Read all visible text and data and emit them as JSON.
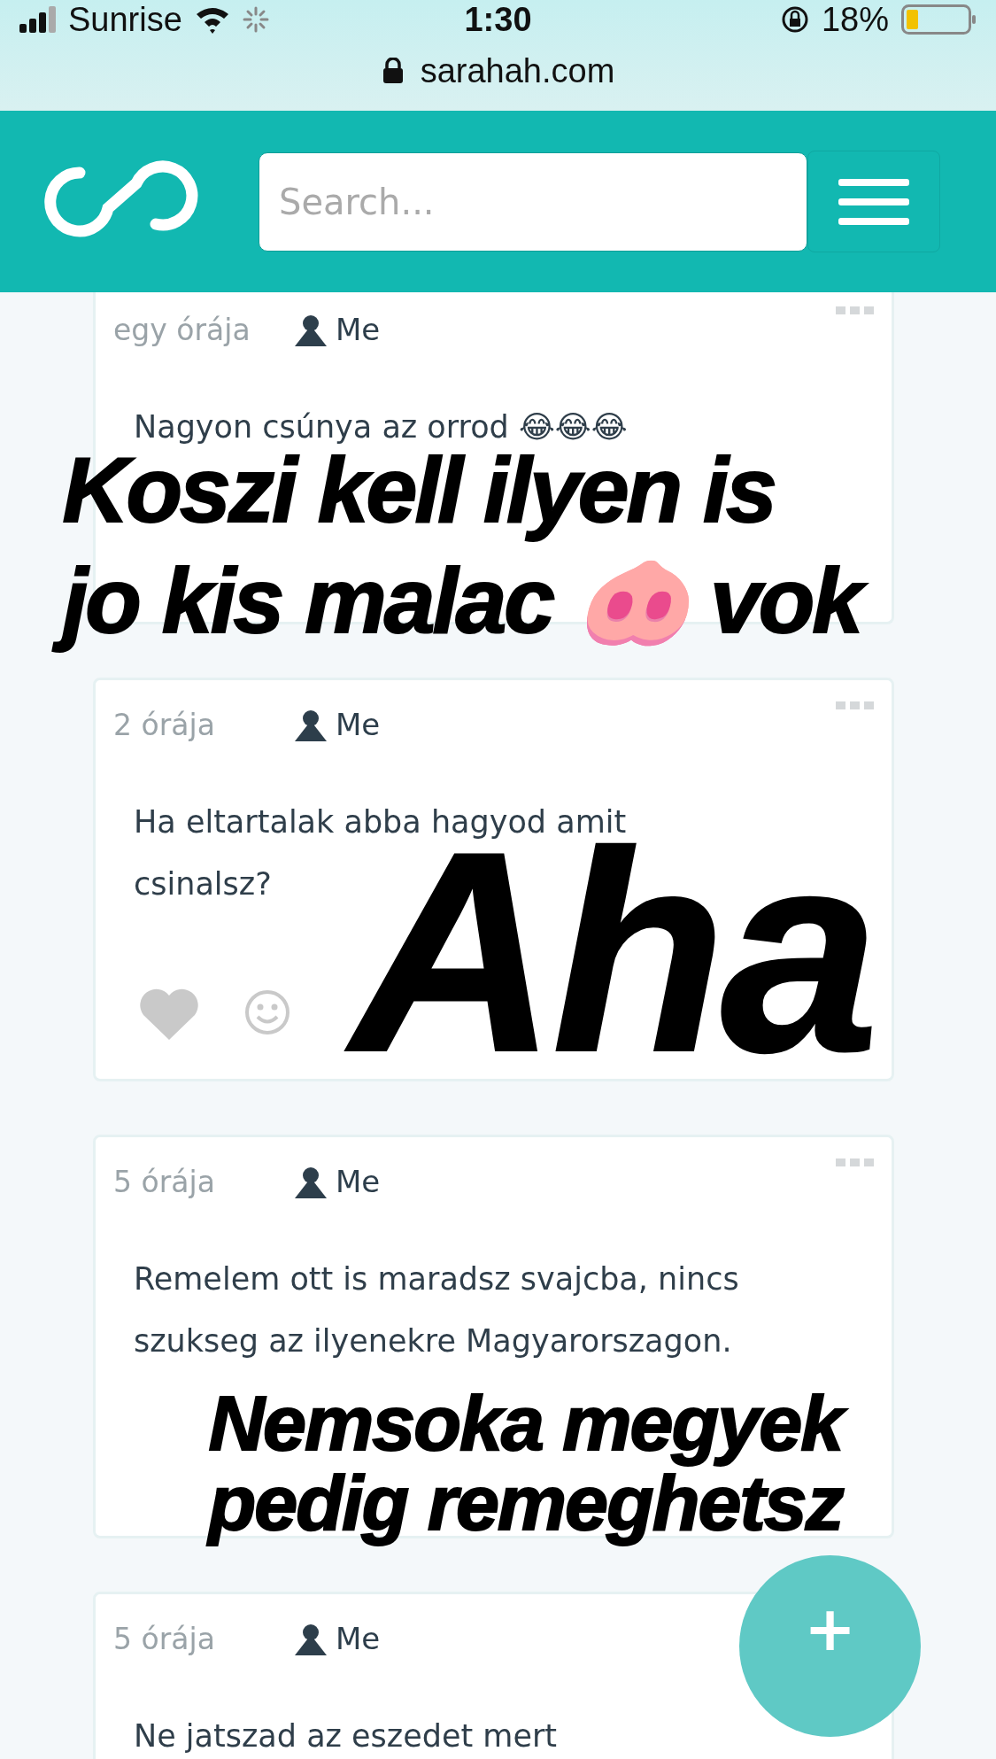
{
  "status_bar": {
    "carrier": "Sunrise",
    "time": "1:30",
    "battery": "18%"
  },
  "address_bar": {
    "url": "sarahah.com"
  },
  "header": {
    "search": {
      "placeholder": "Search..."
    }
  },
  "messages": [
    {
      "time": "egy órája",
      "author": "Me",
      "text": "Nagyon csúnya az orrod 😂😂😂"
    },
    {
      "time": "2 órája",
      "author": "Me",
      "text": "Ha eltartalak abba hagyod amit csinalsz?"
    },
    {
      "time": "5 órája",
      "author": "Me",
      "text": "Remelem ott is maradsz svajcba, nincs szukseg az ilyenekre Magyarorszagon."
    },
    {
      "time": "5 órája",
      "author": "Me",
      "text": "Ne jatszad az eszedet mert"
    }
  ],
  "fab": {
    "label": "+"
  },
  "captions": [
    {
      "lines": [
        "Koszi kell ilyen is",
        "jo kis malac 🐽 vok"
      ]
    },
    {
      "lines": [
        "Aha"
      ]
    },
    {
      "lines": [
        "Nemsoka megyek",
        "pedig remeghetsz"
      ]
    }
  ]
}
